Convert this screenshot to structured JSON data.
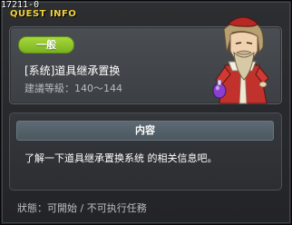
{
  "quest": {
    "id": "17211-0",
    "window_title": "QUEST INFO",
    "category": "一般",
    "name": "[系统]道具继承置换",
    "level_requirement": "建議等級：140～144",
    "content_header": "内容",
    "content_text": "了解一下道具继承置换系统 的相关信息吧。",
    "status": "狀態：可開始 / 不可执行任務"
  },
  "colors": {
    "title": "#f3d23a",
    "badge": "#8ec42b",
    "panel": "#44484d"
  },
  "icons": {
    "npc": "bearded-wizard-npc-portrait"
  }
}
